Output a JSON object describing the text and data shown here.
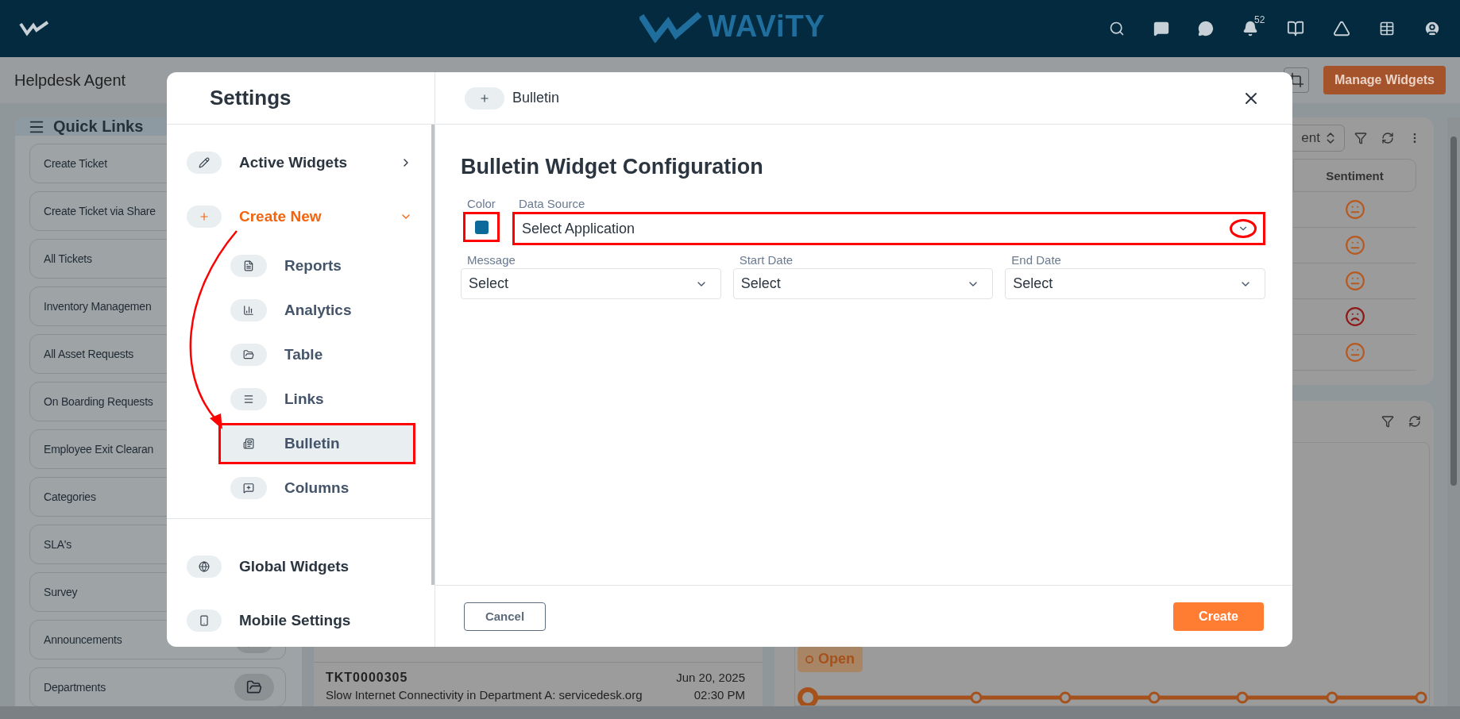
{
  "top_bar": {
    "logo": "WAViTY",
    "notification_count": "52"
  },
  "page": {
    "title": "Helpdesk Agent",
    "manage_button": "Manage Widgets"
  },
  "quick_links": {
    "title": "Quick Links",
    "items": [
      "Create Ticket",
      "Create Ticket via Share",
      "All Tickets",
      "Inventory Managemen",
      "All Asset Requests",
      "On Boarding Requests",
      "Employee Exit Clearan",
      "Categories",
      "SLA's",
      "Survey",
      "Announcements",
      "Departments"
    ]
  },
  "ticket": {
    "id": "TKT0000305",
    "date": "Jun 20, 2025",
    "subject": "Slow Internet Connectivity in Department A: servicedesk.org",
    "time": "02:30 PM"
  },
  "sentiment_card": {
    "sort_label": "ent",
    "column": "Sentiment",
    "rows": [
      {
        "kind": "neutral"
      },
      {
        "kind": "neutral"
      },
      {
        "kind": "neutral"
      },
      {
        "kind": "sad"
      },
      {
        "kind": "neutral"
      }
    ]
  },
  "status": {
    "label": "Open"
  },
  "settings": {
    "title": "Settings",
    "items": [
      {
        "label": "Active Widgets",
        "kind": "expandable",
        "active": false,
        "expanded": false
      },
      {
        "label": "Create New",
        "kind": "expandable",
        "active": true,
        "expanded": true,
        "children": [
          {
            "label": "Reports",
            "selected": false,
            "highlighted": false
          },
          {
            "label": "Analytics",
            "selected": false,
            "highlighted": false
          },
          {
            "label": "Table",
            "selected": false,
            "highlighted": false
          },
          {
            "label": "Links",
            "selected": false,
            "highlighted": false
          },
          {
            "label": "Bulletin",
            "selected": true,
            "highlighted": true
          },
          {
            "label": "Columns",
            "selected": false,
            "highlighted": false
          }
        ]
      },
      {
        "label": "Global Widgets",
        "kind": "link",
        "active": false
      },
      {
        "label": "Mobile Settings",
        "kind": "link",
        "active": false
      }
    ]
  },
  "annotation_arrow": true,
  "dialog": {
    "breadcrumb": "Bulletin",
    "title": "Bulletin Widget Configuration",
    "color_field": {
      "label": "Color",
      "color": "#0b6a99",
      "highlighted": true
    },
    "data_source": {
      "label": "Data Source",
      "value": "Select Application",
      "highlighted": true
    },
    "fields": [
      {
        "label": "Message",
        "value": "Select"
      },
      {
        "label": "Start Date",
        "value": "Select"
      },
      {
        "label": "End Date",
        "value": "Select"
      }
    ],
    "cancel_button": "Cancel",
    "create_button": "Create"
  }
}
